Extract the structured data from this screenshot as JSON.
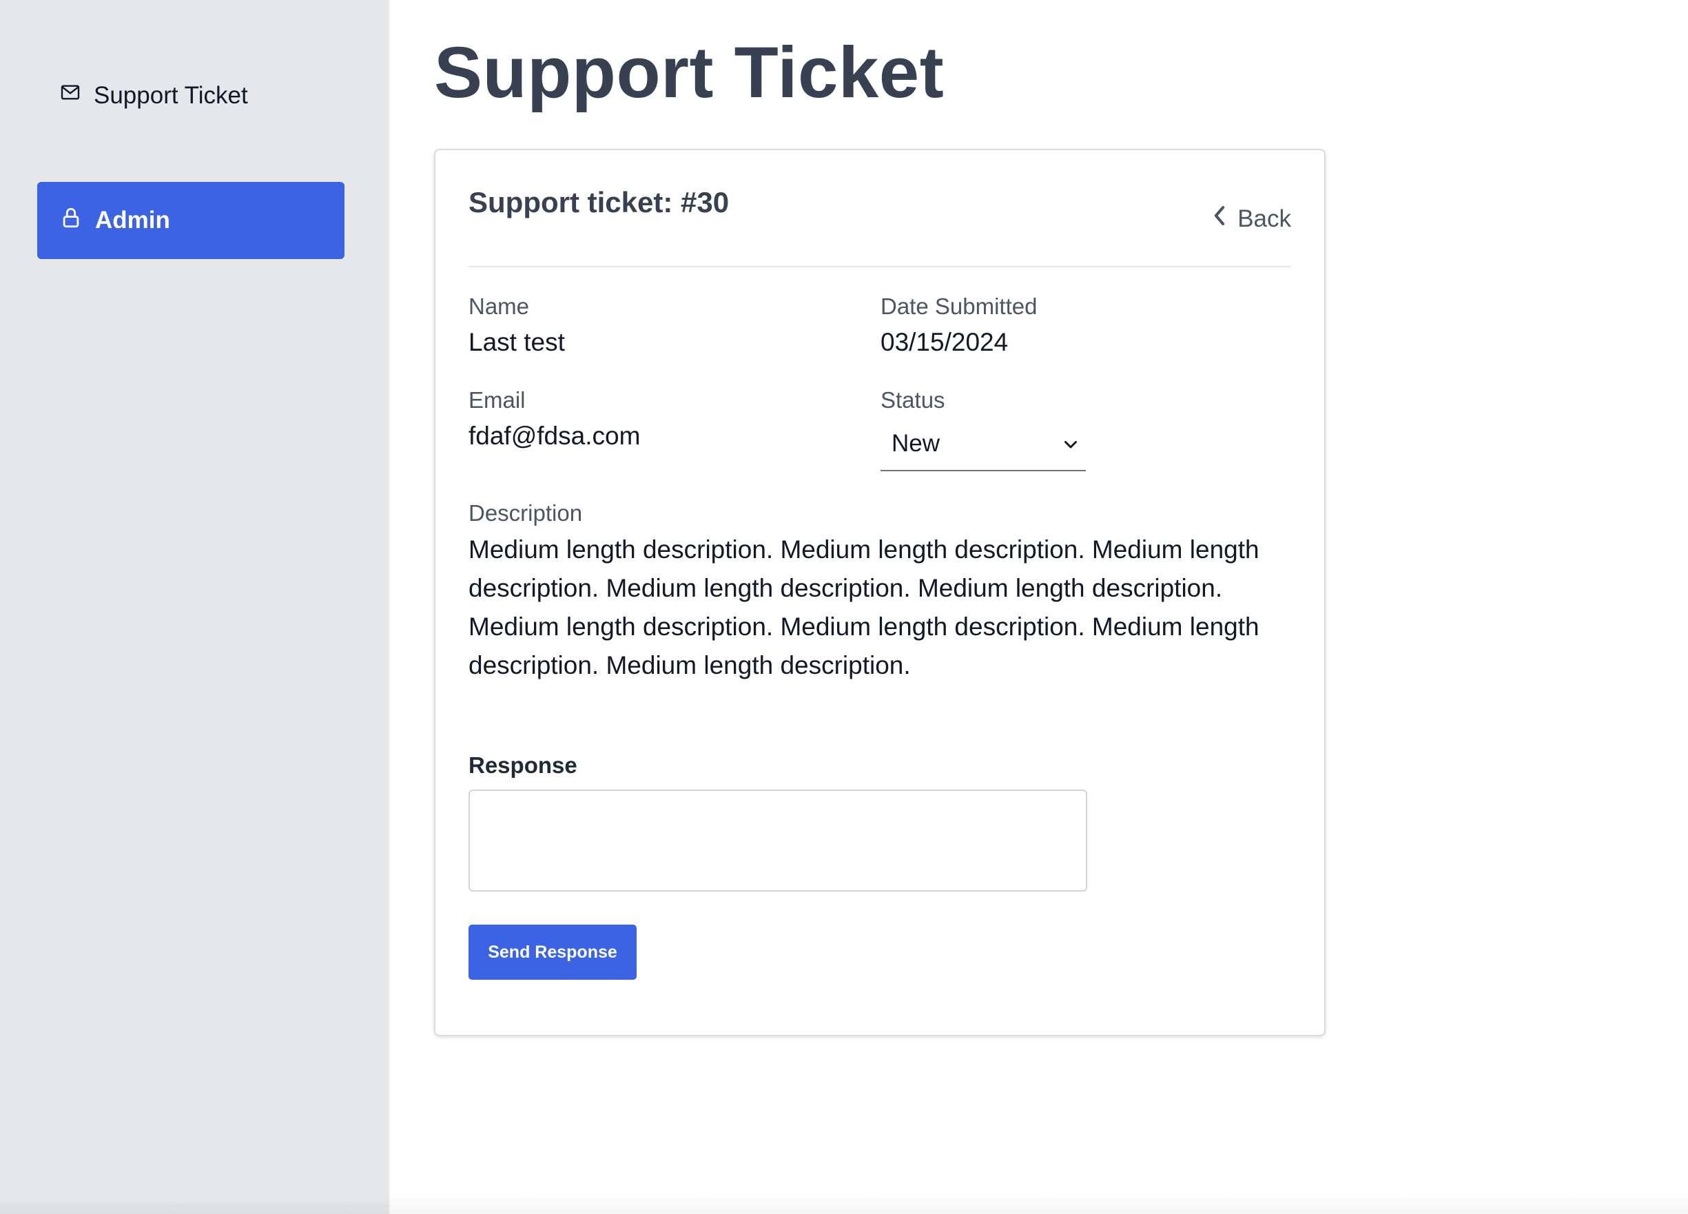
{
  "sidebar": {
    "items": [
      {
        "label": "Support Ticket",
        "icon": "mail-icon",
        "active": false
      },
      {
        "label": "Admin",
        "icon": "lock-icon",
        "active": true
      }
    ]
  },
  "page": {
    "title": "Support Ticket"
  },
  "ticket": {
    "title": "Support ticket: #30",
    "back_label": "Back",
    "name_label": "Name",
    "name_value": "Last test",
    "date_label": "Date Submitted",
    "date_value": "03/15/2024",
    "email_label": "Email",
    "email_value": "fdaf@fdsa.com",
    "status_label": "Status",
    "status_value": "New",
    "description_label": "Description",
    "description_value": "Medium length description. Medium length description. Medium length description. Medium length description. Medium length description. Medium length description. Medium length description. Medium length description. Medium length description.",
    "response_label": "Response",
    "response_value": "",
    "send_label": "Send Response"
  },
  "colors": {
    "accent": "#3b63e3",
    "sidebar_bg": "#e5e7eb",
    "title": "#374151"
  }
}
